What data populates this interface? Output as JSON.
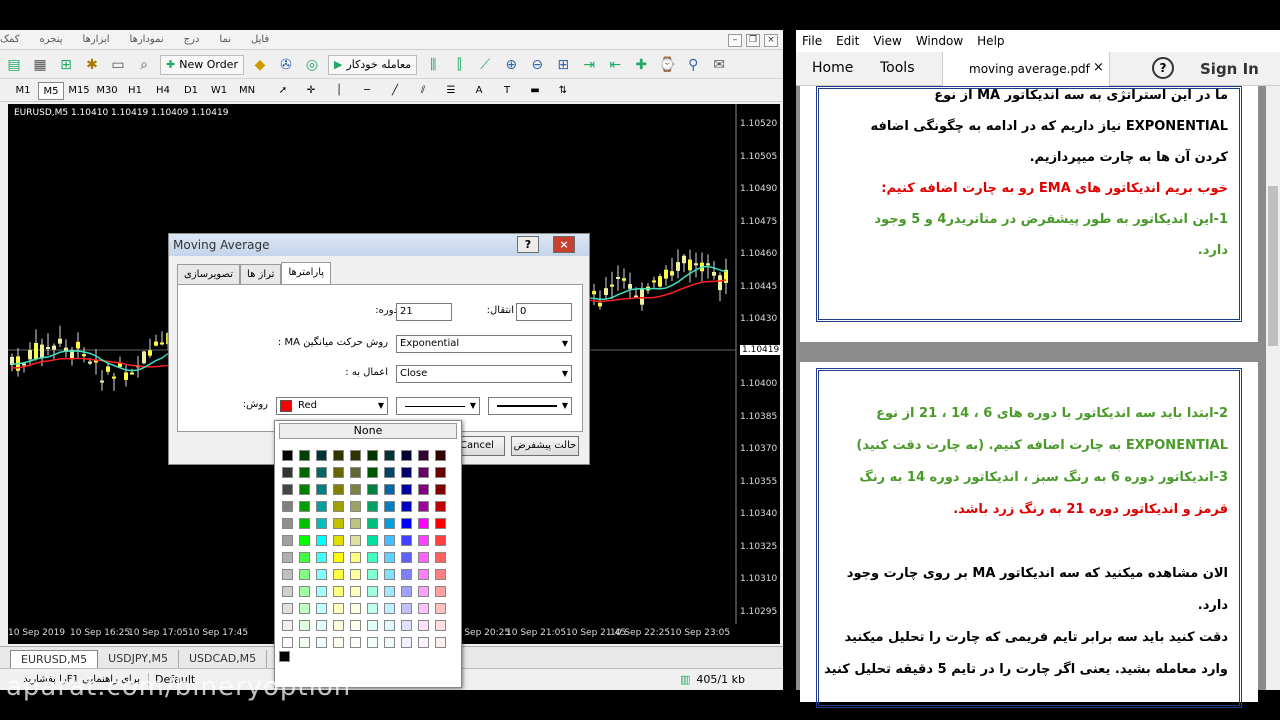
{
  "mt4": {
    "menu": [
      "فایل",
      "نما",
      "درج",
      "نمودارها",
      "ابزارها",
      "پنجره",
      "کمک"
    ],
    "toolbar": {
      "new_order": "New Order",
      "autotrade": "معامله خودکار"
    },
    "timeframes": [
      "M1",
      "M5",
      "M15",
      "M30",
      "H1",
      "H4",
      "D1",
      "W1",
      "MN"
    ],
    "chart_title": "EURUSD,M5  1.10410 1.10419 1.10409 1.10419",
    "current_price": "1.10419",
    "price_labels": [
      "1.10520",
      "1.10505",
      "1.10490",
      "1.10475",
      "1.10460",
      "1.10445",
      "1.10430",
      "1.10415",
      "1.10400",
      "1.10385",
      "1.10370",
      "1.10355",
      "1.10340",
      "1.10325",
      "1.10310",
      "1.10295"
    ],
    "time_labels": [
      "10 Sep 2019",
      "10 Sep 16:25",
      "10 Sep 17:05",
      "10 Sep 17:45",
      "10 Sep 20:25",
      "10 Sep 21:05",
      "10 Sep 21:45",
      "10 Sep 22:25",
      "10 Sep 23:05"
    ],
    "symbol_tabs": [
      "EURUSD,M5",
      "USDJPY,M5",
      "USDCAD,M5"
    ],
    "status": {
      "help": "برای راهنمایی F1را بفشارید",
      "profile": "Default",
      "traffic": "405/1 kb"
    }
  },
  "dialog": {
    "title": "Moving Average",
    "help_button": "?",
    "close_button": "×",
    "tabs": [
      "پارامترها",
      "تراز ها",
      "تصویرسازی"
    ],
    "period_label": "دوره:",
    "period_value": "21",
    "shift_label": "انتقال:",
    "shift_value": "0",
    "method_label": "روش حرکت میانگین MA :",
    "method_value": "Exponential",
    "apply_label": "اعمال به :",
    "apply_value": "Close",
    "style_label": "روش:",
    "color_value": "Red",
    "color_hex": "#ff0000",
    "cancel_button": "Cancel",
    "defaults_button": "حالت پیشفرض"
  },
  "picker": {
    "none_label": "None",
    "colors": [
      "#000000",
      "#004000",
      "#003333",
      "#333300",
      "#333300",
      "#003300",
      "#003333",
      "#000033",
      "#330033",
      "#330000",
      "#333333",
      "#006600",
      "#006666",
      "#666600",
      "#666633",
      "#005500",
      "#004466",
      "#000066",
      "#660066",
      "#660000",
      "#444444",
      "#008000",
      "#008080",
      "#808000",
      "#808040",
      "#008040",
      "#0066aa",
      "#0000a0",
      "#800080",
      "#800000",
      "#808080",
      "#00a000",
      "#00a0a0",
      "#a0a000",
      "#a0a060",
      "#00a060",
      "#0080c0",
      "#0000c0",
      "#a000a0",
      "#c00000",
      "#909090",
      "#00c000",
      "#00c0c0",
      "#c0c000",
      "#c0c080",
      "#00c080",
      "#00a0e0",
      "#0000ff",
      "#ff00ff",
      "#ff0000",
      "#a0a0a0",
      "#00ff00",
      "#00ffff",
      "#e0e000",
      "#e0e0a0",
      "#00e0a0",
      "#40c0ff",
      "#4040ff",
      "#ff40ff",
      "#ff4040",
      "#b0b0b0",
      "#40ff40",
      "#40ffff",
      "#ffff00",
      "#ffff80",
      "#40ffc0",
      "#60d0ff",
      "#6060ff",
      "#ff60ff",
      "#ff6060",
      "#c0c0c0",
      "#80ff80",
      "#80ffff",
      "#ffff40",
      "#ffffa0",
      "#80ffd0",
      "#80e0ff",
      "#8080ff",
      "#ff80ff",
      "#ff8080",
      "#d0d0d0",
      "#a0ffa0",
      "#a0ffff",
      "#ffff80",
      "#ffffc0",
      "#a0ffe0",
      "#a0e8ff",
      "#a0a0ff",
      "#ffa0ff",
      "#ffa0a0",
      "#e0e0e0",
      "#c0ffc0",
      "#c0ffff",
      "#ffffc0",
      "#ffffe0",
      "#c0fff0",
      "#c0f0ff",
      "#c0c0ff",
      "#ffc0ff",
      "#ffc0c0",
      "#f0f0f0",
      "#e0ffe0",
      "#e0ffff",
      "#ffffe0",
      "#fffff0",
      "#e0fff8",
      "#e0f8ff",
      "#e0e0ff",
      "#ffe0ff",
      "#ffe0e0",
      "#ffffff",
      "#f0fff0",
      "#f0ffff",
      "#fffff0",
      "#fffffa",
      "#f0fffc",
      "#f0fcff",
      "#f0f0ff",
      "#fff0ff",
      "#fff0f0"
    ],
    "black_swatch": "#000000"
  },
  "reader": {
    "menu": [
      "File",
      "Edit",
      "View",
      "Window",
      "Help"
    ],
    "nav_home": "Home",
    "nav_tools": "Tools",
    "doc_tab": "moving average.pdf",
    "doc_tab_close": "×",
    "help_icon": "?",
    "sign_in": "Sign In",
    "page1_lines": [
      {
        "text": "ما در این استراتژی به سه اندیکاتور MA از نوع",
        "color": "black"
      },
      {
        "text": "EXPONENTIAL نیاز داریم که در ادامه به چگونگی اضافه",
        "color": "black"
      },
      {
        "text": "کردن آن ها به چارت میپردازیم.",
        "color": "black"
      },
      {
        "text": "خوب بریم اندیکاتور های EMA رو به چارت اضافه کنیم:",
        "color": "red"
      },
      {
        "text": "1-این اندیکاتور به طور پیشفرض در متاتریدر4 و 5 وجود",
        "color": "green"
      },
      {
        "text": "دارد.",
        "color": "green"
      }
    ],
    "page2_lines": [
      {
        "text": "2-ابتدا باید سه اندیکاتور با دوره های 6 ، 14 ، 21 از نوع",
        "color": "green"
      },
      {
        "text": "EXPONENTIAL به چارت اضافه کنیم. (به چارت دقت کنید)",
        "color": "green"
      },
      {
        "text": "3-اندیکاتور دوره 6 به رنگ سبز ، اندیکاتور دوره 14 به رنگ",
        "color": "green"
      },
      {
        "text": "قرمز و اندیکاتور دوره 21 به رنگ زرد باشد.",
        "color": "red"
      },
      {
        "text": "",
        "color": "black"
      },
      {
        "text": "الان مشاهده میکنید که سه اندیکاتور MA بر روی چارت وجود",
        "color": "black"
      },
      {
        "text": "دارد.",
        "color": "black"
      },
      {
        "text": "دقت کنید باید سه برابر تایم فریمی که چارت را تحلیل میکنید",
        "color": "black"
      },
      {
        "text": "وارد معامله بشید. یعنی اگر چارت را در تایم 5 دقیقه تحلیل کنید",
        "color": "black"
      }
    ]
  },
  "watermark": "aparat.com/bineryoption"
}
